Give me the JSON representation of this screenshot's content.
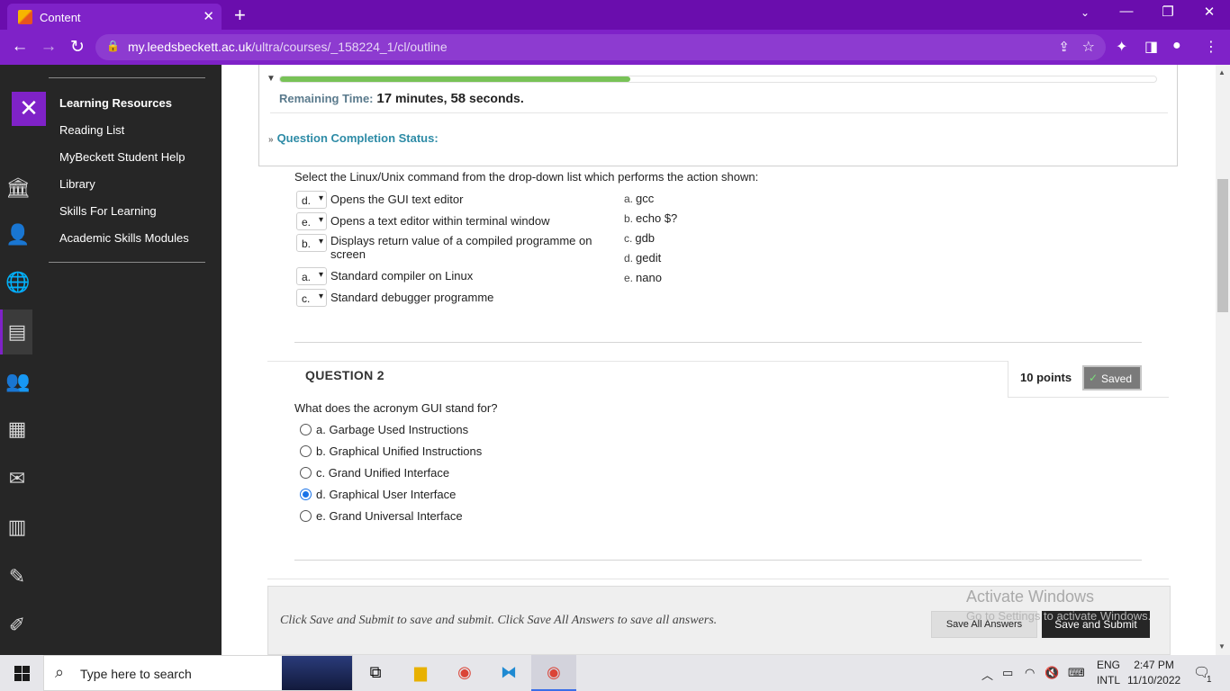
{
  "browser": {
    "tab_title": "Content",
    "url_host": "my.leedsbeckett.ac.uk",
    "url_path": "/ultra/courses/_158224_1/cl/outline"
  },
  "flyout": {
    "items": [
      {
        "label": "Learning Resources",
        "bold": true
      },
      {
        "label": "Reading List"
      },
      {
        "label": "MyBeckett Student Help"
      },
      {
        "label": "Library"
      },
      {
        "label": "Skills For Learning"
      },
      {
        "label": "Academic Skills Modules"
      }
    ]
  },
  "timer": {
    "label": "Remaining Time:",
    "minutes": "17",
    "minutes_word": " minutes, ",
    "seconds": "58",
    "seconds_word": " seconds.",
    "progress": 0.4
  },
  "completion_status": "Question Completion Status:",
  "question1": {
    "intro": "Select the Linux/Unix command from the drop-down list which performs the action shown:",
    "items": [
      {
        "selected": "d.",
        "text": "Opens the GUI text editor"
      },
      {
        "selected": "e.",
        "text": "Opens a text editor within terminal window"
      },
      {
        "selected": "b.",
        "text": "Displays return value of a compiled programme on screen"
      },
      {
        "selected": "a.",
        "text": "Standard compiler on Linux"
      },
      {
        "selected": "c.",
        "text": "Standard debugger programme"
      }
    ],
    "answers": [
      {
        "key": "a.",
        "text": "gcc"
      },
      {
        "key": "b.",
        "text": "echo $?"
      },
      {
        "key": "c.",
        "text": "gdb"
      },
      {
        "key": "d.",
        "text": "gedit"
      },
      {
        "key": "e.",
        "text": "nano"
      }
    ]
  },
  "question2": {
    "title": "QUESTION 2",
    "points": "10 points",
    "saved": "Saved",
    "text": "What does the acronym GUI stand for?",
    "options": [
      {
        "label": "a. Garbage Used Instructions",
        "checked": false
      },
      {
        "label": "b. Graphical Unified Instructions",
        "checked": false
      },
      {
        "label": "c. Grand Unified Interface",
        "checked": false
      },
      {
        "label": "d. Graphical User Interface",
        "checked": true
      },
      {
        "label": "e. Grand Universal Interface",
        "checked": false
      }
    ]
  },
  "footer": {
    "text": "Click Save and Submit to save and submit. Click Save All Answers to save all answers.",
    "save_all": "Save All Answers",
    "save_submit": "Save and Submit"
  },
  "watermark": {
    "line1": "Activate Windows",
    "line2": "Go to Settings to activate Windows."
  },
  "taskbar": {
    "search_placeholder": "Type here to search",
    "lang1": "ENG",
    "lang2": "INTL",
    "time": "2:47 PM",
    "date": "11/10/2022",
    "notifications": "1"
  }
}
